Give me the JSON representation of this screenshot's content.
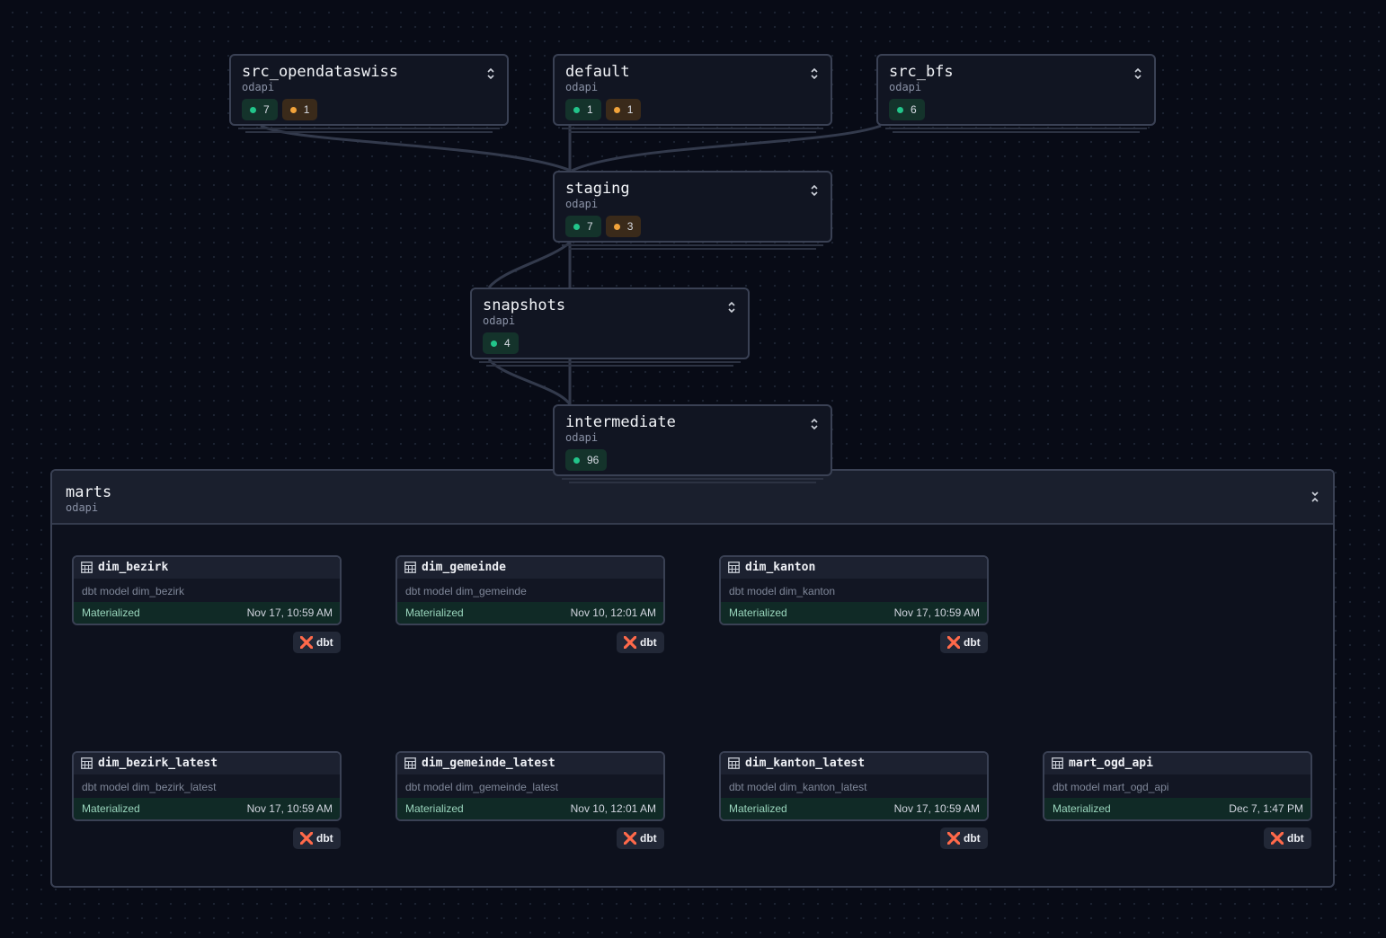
{
  "groups": {
    "src_opendataswiss": {
      "title": "src_opendataswiss",
      "subtitle": "odapi",
      "green": "7",
      "orange": "1"
    },
    "default": {
      "title": "default",
      "subtitle": "odapi",
      "green": "1",
      "orange": "1"
    },
    "src_bfs": {
      "title": "src_bfs",
      "subtitle": "odapi",
      "green": "6"
    },
    "staging": {
      "title": "staging",
      "subtitle": "odapi",
      "green": "7",
      "orange": "3"
    },
    "snapshots": {
      "title": "snapshots",
      "subtitle": "odapi",
      "green": "4"
    },
    "intermediate": {
      "title": "intermediate",
      "subtitle": "odapi",
      "green": "96"
    }
  },
  "marts": {
    "title": "marts",
    "subtitle": "odapi",
    "models": [
      {
        "name": "dim_bezirk",
        "description": "dbt model dim_bezirk",
        "status": "Materialized",
        "date": "Nov 17, 10:59 AM",
        "tag": "dbt"
      },
      {
        "name": "dim_gemeinde",
        "description": "dbt model dim_gemeinde",
        "status": "Materialized",
        "date": "Nov 10, 12:01 AM",
        "tag": "dbt"
      },
      {
        "name": "dim_kanton",
        "description": "dbt model dim_kanton",
        "status": "Materialized",
        "date": "Nov 17, 10:59 AM",
        "tag": "dbt"
      },
      {
        "name": "dim_bezirk_latest",
        "description": "dbt model dim_bezirk_latest",
        "status": "Materialized",
        "date": "Nov 17, 10:59 AM",
        "tag": "dbt"
      },
      {
        "name": "dim_gemeinde_latest",
        "description": "dbt model dim_gemeinde_latest",
        "status": "Materialized",
        "date": "Nov 10, 12:01 AM",
        "tag": "dbt"
      },
      {
        "name": "dim_kanton_latest",
        "description": "dbt model dim_kanton_latest",
        "status": "Materialized",
        "date": "Nov 17, 10:59 AM",
        "tag": "dbt"
      },
      {
        "name": "mart_ogd_api",
        "description": "dbt model mart_ogd_api",
        "status": "Materialized",
        "date": "Dec 7, 1:47 PM",
        "tag": "dbt"
      }
    ]
  },
  "icons": {
    "expand": "expand-icon",
    "collapse": "collapse-icon",
    "model": "table-icon",
    "dbt": "dbt-logo-icon"
  },
  "colors": {
    "background": "#080b16",
    "status_green": "#22c58a",
    "status_orange": "#f2a33a",
    "dbt_orange": "#ff694a",
    "materialized_bg": "#102a26"
  }
}
